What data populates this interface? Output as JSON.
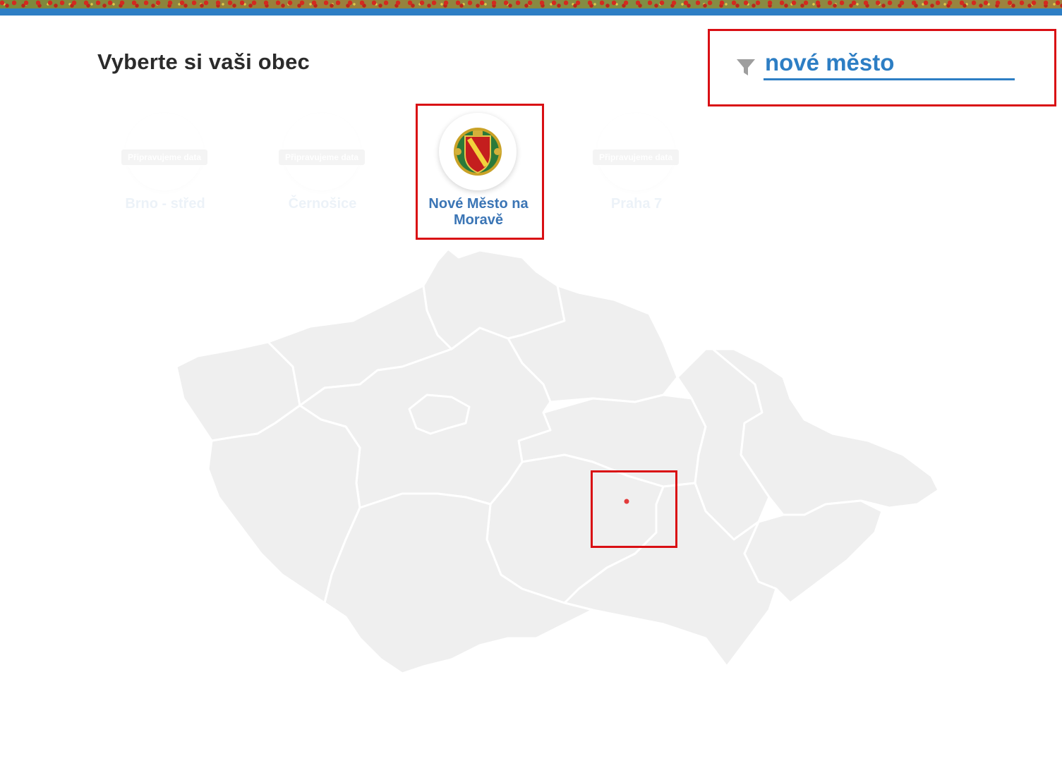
{
  "header": {
    "banner_colors": [
      "#d32a1f",
      "#7a8a3d",
      "#2d7ec4"
    ]
  },
  "page": {
    "title": "Vyberte si vaši obec"
  },
  "search": {
    "value": "nové město",
    "icon": "filter-icon"
  },
  "cards": [
    {
      "name": "Brno - střed",
      "tag": "Připravujeme data",
      "state": "disabled"
    },
    {
      "name": "Černošice",
      "tag": "Připravujeme data",
      "state": "disabled"
    },
    {
      "name": "Nové Město na Moravě",
      "state": "active",
      "icon": "coat-of-arms-icon"
    },
    {
      "name": "Praha 7",
      "tag": "Připravujeme data",
      "state": "disabled"
    }
  ],
  "map": {
    "region_fill": "#efefef",
    "border_color": "#ffffff",
    "marker_color": "#e23b3b",
    "highlight_color": "#d90f14"
  }
}
